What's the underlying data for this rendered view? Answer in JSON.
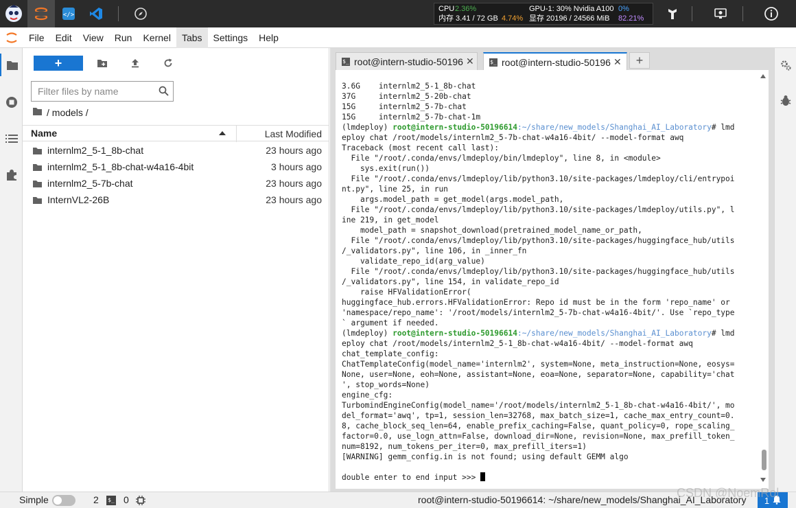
{
  "stats": {
    "cpu_label": "CPU",
    "cpu_value": "2.36%",
    "mem_label": "内存 3.41 / 72 GB",
    "mem_value": "4.74%",
    "gpu_label": "GPU-1: 30% Nvidia A100",
    "gpu_value": "0%",
    "vram_label": "显存 20196 / 24566 MiB",
    "vram_value": "82.21%"
  },
  "menu": [
    "File",
    "Edit",
    "View",
    "Run",
    "Kernel",
    "Tabs",
    "Settings",
    "Help"
  ],
  "filebrowser": {
    "new_label": "+",
    "filter_placeholder": "Filter files by name",
    "breadcrumb": "/ models /",
    "col_name": "Name",
    "col_modified": "Last Modified",
    "files": [
      {
        "name": "internlm2_5-1_8b-chat",
        "modified": "23 hours ago"
      },
      {
        "name": "internlm2_5-1_8b-chat-w4a16-4bit",
        "modified": "3 hours ago"
      },
      {
        "name": "internlm2_5-7b-chat",
        "modified": "23 hours ago"
      },
      {
        "name": "InternVL2-26B",
        "modified": "23 hours ago"
      }
    ]
  },
  "tabs": [
    {
      "label": "root@intern-studio-50196",
      "close": "✕"
    },
    {
      "label": "root@intern-studio-50196",
      "close": "✕"
    }
  ],
  "tab_add": "+",
  "terminal": {
    "lines": [
      "3.6G    internlm2_5-1_8b-chat",
      "37G     internlm2_5-20b-chat",
      "15G     internlm2_5-7b-chat",
      "15G     internlm2_5-7b-chat-1m",
      "eploy chat /root/models/internlm2_5-7b-chat-w4a16-4bit/ --model-format awq",
      "Traceback (most recent call last):",
      "  File \"/root/.conda/envs/lmdeploy/bin/lmdeploy\", line 8, in <module>",
      "    sys.exit(run())",
      "  File \"/root/.conda/envs/lmdeploy/lib/python3.10/site-packages/lmdeploy/cli/entrypoi",
      "nt.py\", line 25, in run",
      "    args.model_path = get_model(args.model_path,",
      "  File \"/root/.conda/envs/lmdeploy/lib/python3.10/site-packages/lmdeploy/utils.py\", l",
      "ine 219, in get_model",
      "    model_path = snapshot_download(pretrained_model_name_or_path,",
      "  File \"/root/.conda/envs/lmdeploy/lib/python3.10/site-packages/huggingface_hub/utils",
      "/_validators.py\", line 106, in _inner_fn",
      "    validate_repo_id(arg_value)",
      "  File \"/root/.conda/envs/lmdeploy/lib/python3.10/site-packages/huggingface_hub/utils",
      "/_validators.py\", line 154, in validate_repo_id",
      "    raise HFValidationError(",
      "huggingface_hub.errors.HFValidationError: Repo id must be in the form 'repo_name' or",
      "'namespace/repo_name': '/root/models/internlm2_5-7b-chat-w4a16-4bit/'. Use `repo_type",
      "` argument if needed.",
      "eploy chat /root/models/internlm2_5-1_8b-chat-w4a16-4bit/ --model-format awq",
      "chat_template_config:",
      "ChatTemplateConfig(model_name='internlm2', system=None, meta_instruction=None, eosys=",
      "None, user=None, eoh=None, assistant=None, eoa=None, separator=None, capability='chat",
      "', stop_words=None)",
      "engine_cfg:",
      "TurbomindEngineConfig(model_name='/root/models/internlm2_5-1_8b-chat-w4a16-4bit/', mo",
      "del_format='awq', tp=1, session_len=32768, max_batch_size=1, cache_max_entry_count=0.",
      "8, cache_block_seq_len=64, enable_prefix_caching=False, quant_policy=0, rope_scaling_",
      "factor=0.0, use_logn_attn=False, download_dir=None, revision=None, max_prefill_token_",
      "num=8192, num_tokens_per_iter=0, max_prefill_iters=1)",
      "[WARNING] gemm_config.in is not found; using default GEMM algo",
      "",
      "double enter to end input >>> "
    ],
    "prompt_env": "(lmdeploy) ",
    "prompt_user": "root@intern-studio-50196614",
    "prompt_path": ":~/share/new_models/Shanghai_AI_Laboratory",
    "prompt_end": "# lmd"
  },
  "status": {
    "mode_label": "Simple",
    "terminals_count": "2",
    "kernels_count": "0",
    "path_text": "root@intern-studio-50196614: ~/share/new_models/Shanghai_AI_Laboratory",
    "notif_count": "1"
  },
  "watermark": "CSDN @NoemRol",
  "colors": {
    "accent": "#1976d2",
    "prompt_user": "#2e9a2e",
    "prompt_path": "#5a8fd0"
  }
}
